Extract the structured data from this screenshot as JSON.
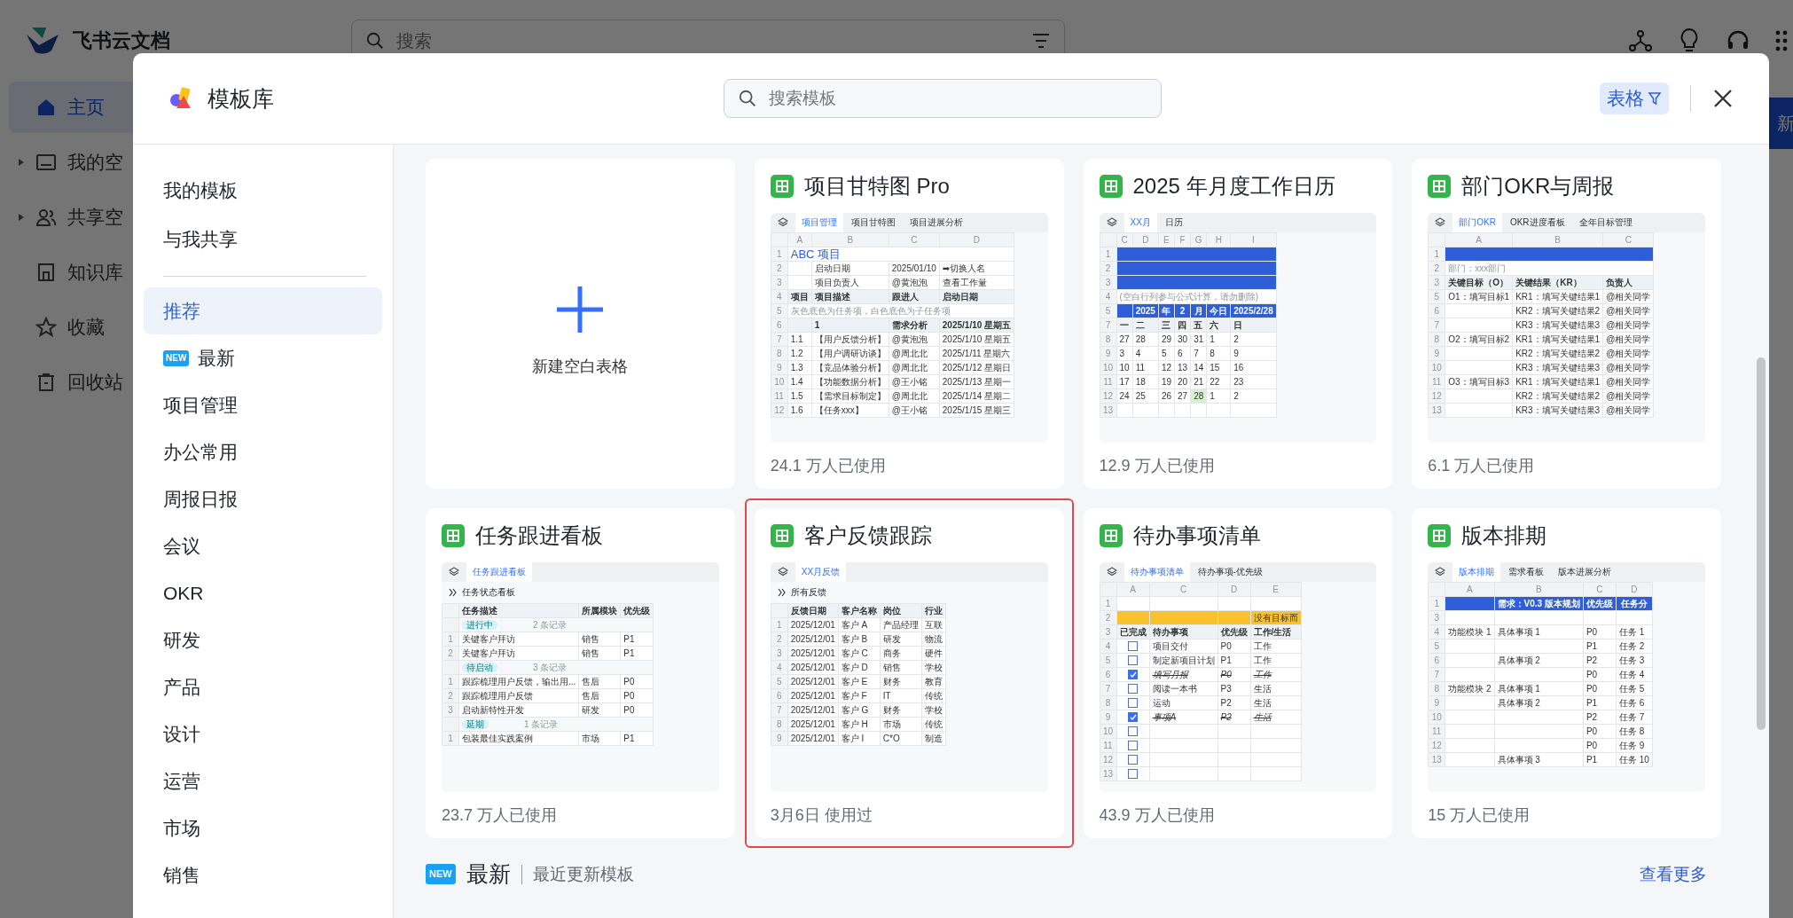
{
  "app": {
    "name": "飞书云文档",
    "search": {
      "placeholder": "搜索"
    },
    "new_button": "新",
    "nav": [
      {
        "label": "主页",
        "selected": true
      },
      {
        "label": "我的空",
        "selected": false,
        "expandable": true
      },
      {
        "label": "共享空",
        "selected": false,
        "expandable": true
      },
      {
        "label": "知识库",
        "selected": false
      },
      {
        "label": "收藏",
        "selected": false
      },
      {
        "label": "回收站",
        "selected": false
      }
    ]
  },
  "modal": {
    "title": "模板库",
    "search": {
      "placeholder": "搜索模板"
    },
    "filter": "表格",
    "my_links": [
      "我的模板",
      "与我共享"
    ],
    "categories": [
      {
        "label": "推荐",
        "selected": true
      },
      {
        "label": "最新",
        "selected": false,
        "badge": "NEW"
      },
      {
        "label": "项目管理",
        "selected": false
      },
      {
        "label": "办公常用",
        "selected": false
      },
      {
        "label": "周报日报",
        "selected": false
      },
      {
        "label": "会议",
        "selected": false
      },
      {
        "label": "OKR",
        "selected": false
      },
      {
        "label": "研发",
        "selected": false
      },
      {
        "label": "产品",
        "selected": false
      },
      {
        "label": "设计",
        "selected": false
      },
      {
        "label": "运营",
        "selected": false
      },
      {
        "label": "市场",
        "selected": false
      },
      {
        "label": "销售",
        "selected": false
      }
    ],
    "cards": [
      {
        "kind": "blank",
        "label": "新建空白表格"
      },
      {
        "kind": "template",
        "title": "项目甘特图 Pro",
        "usage": "24.1 万人已使用",
        "highlighted": false,
        "thumb": {
          "tabs": [
            {
              "label": "项目管理",
              "selected": true
            },
            {
              "label": "项目甘特图",
              "selected": false
            },
            {
              "label": "项目进展分析",
              "selected": false
            }
          ],
          "letters": [
            "A",
            "B",
            "C",
            "D"
          ],
          "rows": [
            {
              "n": "1",
              "kind": "title",
              "cells": [
                "ABC 项目"
              ]
            },
            {
              "n": "2",
              "kind": "row",
              "cells": [
                "启动日期",
                "2025/01/10",
                "➡切换人名"
              ]
            },
            {
              "n": "3",
              "kind": "row",
              "cells": [
                "项目负责人",
                "@黄泡泡",
                "查看工作量"
              ]
            },
            {
              "n": "4",
              "kind": "header",
              "cells": [
                "项目",
                "项目描述",
                "跟进人",
                "启动日期"
              ]
            },
            {
              "n": "5",
              "kind": "note",
              "cells": [
                "灰色底色为任务项，白色底色为子任务项"
              ]
            },
            {
              "n": "6",
              "kind": "header",
              "cells": [
                "1",
                "需求分析",
                "2025/1/10 星期五"
              ]
            },
            {
              "n": "7",
              "kind": "row",
              "cells": [
                "1.1",
                "【用户反馈分析】",
                "@黄泡泡",
                "2025/1/10 星期五"
              ]
            },
            {
              "n": "8",
              "kind": "row",
              "cells": [
                "1.2",
                "【用户调研访谈】",
                "@周北北",
                "2025/1/11 星期六"
              ]
            },
            {
              "n": "9",
              "kind": "row",
              "cells": [
                "1.3",
                "【竞品体验分析】",
                "@周北北",
                "2025/1/12 星期日"
              ]
            },
            {
              "n": "10",
              "kind": "row",
              "cells": [
                "1.4",
                "【功能数据分析】",
                "@王小铭",
                "2025/1/13 星期一"
              ]
            },
            {
              "n": "11",
              "kind": "row",
              "cells": [
                "1.5",
                "【需求目标制定】",
                "@周北北",
                "2025/1/14 星期二"
              ]
            },
            {
              "n": "12",
              "kind": "row",
              "cells": [
                "1.6",
                "【任务xxx】",
                "@王小铭",
                "2025/1/15 星期三"
              ]
            }
          ]
        }
      },
      {
        "kind": "template",
        "title": "2025 年月度工作日历",
        "usage": "12.9 万人已使用",
        "highlighted": false,
        "thumb": {
          "tabs": [
            {
              "label": "XX月",
              "selected": true
            },
            {
              "label": "日历",
              "selected": false
            }
          ],
          "letters": [
            "C",
            "D",
            "E",
            "F",
            "G",
            "H",
            "I"
          ],
          "rows": [
            {
              "n": "1",
              "kind": "band",
              "cells": []
            },
            {
              "n": "2",
              "kind": "band",
              "cells": []
            },
            {
              "n": "3",
              "kind": "band",
              "cells": []
            },
            {
              "n": "4",
              "kind": "note",
              "cells": [
                "(空白行列参与公式计算，请勿删除)"
              ]
            },
            {
              "n": "5",
              "kind": "band",
              "cells": [
                "",
                "2025",
                "年",
                "2",
                "月",
                "今日",
                "2025/2/28"
              ]
            },
            {
              "n": "7",
              "kind": "header",
              "cells": [
                "一",
                "二",
                "三",
                "四",
                "五",
                "六",
                "日"
              ]
            },
            {
              "n": "8",
              "kind": "row",
              "cells": [
                "27",
                "28",
                "29",
                "30",
                "31",
                "1",
                "2"
              ]
            },
            {
              "n": "9",
              "kind": "row",
              "cells": [
                "3",
                "4",
                "5",
                "6",
                "7",
                "8",
                "9"
              ]
            },
            {
              "n": "10",
              "kind": "row",
              "cells": [
                "10",
                "11",
                "12",
                "13",
                "14",
                "15",
                "16"
              ]
            },
            {
              "n": "11",
              "kind": "row",
              "cells": [
                "17",
                "18",
                "19",
                "20",
                "21",
                "22",
                "23"
              ]
            },
            {
              "n": "12",
              "kind": "row",
              "cells": [
                "24",
                "25",
                "26",
                "27",
                {
                  "text": "28",
                  "highlighted": true
                },
                "1",
                "2"
              ]
            },
            {
              "n": "13",
              "kind": "row",
              "cells": []
            }
          ]
        }
      },
      {
        "kind": "template",
        "title": "部门OKR与周报",
        "usage": "6.1 万人已使用",
        "highlighted": false,
        "thumb": {
          "tabs": [
            {
              "label": "部门OKR",
              "selected": true
            },
            {
              "label": "OKR进度看板",
              "selected": false
            },
            {
              "label": "全年目标管理",
              "selected": false
            }
          ],
          "letters": [
            "A",
            "B",
            "C"
          ],
          "rows": [
            {
              "n": "1",
              "kind": "band",
              "cells": []
            },
            {
              "n": "2",
              "kind": "note",
              "cells": [
                "部门：xxx部门"
              ]
            },
            {
              "n": "3",
              "kind": "header",
              "cells": [
                "关键目标（O）",
                "关键结果（KR）",
                "负责人"
              ]
            },
            {
              "n": "5",
              "kind": "row",
              "cells": [
                "O1：填写目标1",
                "KR1：填写关键结果1",
                "@相关同学"
              ]
            },
            {
              "n": "6",
              "kind": "row",
              "cells": [
                "KR2：填写关键结果2",
                "@相关同学"
              ]
            },
            {
              "n": "7",
              "kind": "row",
              "cells": [
                "KR3：填写关键结果3",
                "@相关同学"
              ]
            },
            {
              "n": "8",
              "kind": "row",
              "cells": [
                "O2：填写目标2",
                "KR1：填写关键结果1",
                "@相关同学"
              ]
            },
            {
              "n": "9",
              "kind": "row",
              "cells": [
                "KR2：填写关键结果2",
                "@相关同学"
              ]
            },
            {
              "n": "10",
              "kind": "row",
              "cells": [
                "KR3：填写关键结果3",
                "@相关同学"
              ]
            },
            {
              "n": "11",
              "kind": "row",
              "cells": [
                "O3：填写目标3",
                "KR1：填写关键结果1",
                "@相关同学"
              ]
            },
            {
              "n": "12",
              "kind": "row",
              "cells": [
                "KR2：填写关键结果2",
                "@相关同学"
              ]
            },
            {
              "n": "13",
              "kind": "row",
              "cells": [
                "KR3：填写关键结果3",
                "@相关同学"
              ]
            }
          ]
        }
      },
      {
        "kind": "template",
        "title": "任务跟进看板",
        "usage": "23.7 万人已使用",
        "highlighted": false,
        "thumb": {
          "tabs": [
            {
              "label": "任务跟进看板",
              "selected": true
            }
          ],
          "caption": "任务状态看板",
          "rows": [
            {
              "kind": "header",
              "cells": [
                "任务描述",
                "所属模块",
                "优先级"
              ]
            },
            {
              "kind": "group",
              "cells": [
                "进行中",
                "2 条记录"
              ]
            },
            {
              "n": "1",
              "kind": "row",
              "cells": [
                "关键客户拜访",
                "销售",
                "P1"
              ]
            },
            {
              "n": "2",
              "kind": "row",
              "cells": [
                "关键客户拜访",
                "销售",
                "P1"
              ]
            },
            {
              "kind": "group",
              "cells": [
                "待启动",
                "3 条记录"
              ]
            },
            {
              "n": "1",
              "kind": "row",
              "cells": [
                "跟踪梳理用户反馈，输出用...",
                "售后",
                "P0"
              ]
            },
            {
              "n": "2",
              "kind": "row",
              "cells": [
                "跟踪梳理用户反馈",
                "售后",
                "P0"
              ]
            },
            {
              "n": "3",
              "kind": "row",
              "cells": [
                "启动新特性开发",
                "研发",
                "P0"
              ]
            },
            {
              "kind": "group",
              "cells": [
                "延期",
                "1 条记录"
              ]
            },
            {
              "n": "1",
              "kind": "row",
              "cells": [
                "包装最佳实践案例",
                "市场",
                "P1"
              ]
            }
          ]
        }
      },
      {
        "kind": "template",
        "title": "客户反馈跟踪",
        "usage": "3月6日 使用过",
        "highlighted": true,
        "thumb": {
          "tabs": [
            {
              "label": "XX月反馈",
              "selected": true
            }
          ],
          "caption": "所有反馈",
          "rows": [
            {
              "kind": "header",
              "cells": [
                "反馈日期",
                "客户名称",
                "岗位",
                "行业"
              ]
            },
            {
              "n": "1",
              "kind": "row",
              "cells": [
                "2025/12/01",
                "客户 A",
                "产品经理",
                "互联"
              ]
            },
            {
              "n": "2",
              "kind": "row",
              "cells": [
                "2025/12/01",
                "客户 B",
                "研发",
                "物流"
              ]
            },
            {
              "n": "3",
              "kind": "row",
              "cells": [
                "2025/12/01",
                "客户 C",
                "商务",
                "硬件"
              ]
            },
            {
              "n": "4",
              "kind": "row",
              "cells": [
                "2025/12/01",
                "客户 D",
                "销售",
                "学校"
              ]
            },
            {
              "n": "5",
              "kind": "row",
              "cells": [
                "2025/12/01",
                "客户 E",
                "财务",
                "教育"
              ]
            },
            {
              "n": "6",
              "kind": "row",
              "cells": [
                "2025/12/01",
                "客户 F",
                "IT",
                "传统"
              ]
            },
            {
              "n": "7",
              "kind": "row",
              "cells": [
                "2025/12/01",
                "客户 G",
                "财务",
                "学校"
              ]
            },
            {
              "n": "8",
              "kind": "row",
              "cells": [
                "2025/12/01",
                "客户 H",
                "市场",
                "传统"
              ]
            },
            {
              "n": "9",
              "kind": "row",
              "cells": [
                "2025/12/01",
                "客户 I",
                "C*O",
                "制造"
              ]
            }
          ]
        }
      },
      {
        "kind": "template",
        "title": "待办事项清单",
        "usage": "43.9 万人已使用",
        "highlighted": false,
        "thumb": {
          "tabs": [
            {
              "label": "待办事项清单",
              "selected": true
            },
            {
              "label": "待办事项-优先级",
              "selected": false
            }
          ],
          "letters": [
            "A",
            "C",
            "D",
            "E"
          ],
          "rows": [
            {
              "n": "1",
              "kind": "row",
              "cells": []
            },
            {
              "n": "2",
              "kind": "banner",
              "cells": [
                "",
                "",
                "",
                "没有目标而"
              ]
            },
            {
              "n": "3",
              "kind": "header",
              "cells": [
                "已完成",
                "待办事项",
                "优先级",
                "工作/生活"
              ]
            },
            {
              "n": "4",
              "kind": "row",
              "check": false,
              "cells": [
                "",
                "项目交付",
                "P0",
                "工作"
              ]
            },
            {
              "n": "5",
              "kind": "row",
              "check": false,
              "cells": [
                "",
                "制定新项目计划",
                "P1",
                "工作"
              ]
            },
            {
              "n": "6",
              "kind": "row",
              "check": true,
              "cells": [
                "",
                "填写月报",
                "P0",
                "工作"
              ]
            },
            {
              "n": "7",
              "kind": "row",
              "check": false,
              "cells": [
                "",
                "阅读一本书",
                "P3",
                "生活"
              ]
            },
            {
              "n": "8",
              "kind": "row",
              "check": false,
              "cells": [
                "",
                "运动",
                "P2",
                "生活"
              ]
            },
            {
              "n": "9",
              "kind": "row",
              "check": true,
              "cells": [
                "",
                "事项A",
                "P2",
                "生活"
              ]
            },
            {
              "n": "10",
              "kind": "row",
              "check": false,
              "cells": [
                "",
                "",
                "",
                ""
              ]
            },
            {
              "n": "11",
              "kind": "row",
              "check": false,
              "cells": [
                "",
                "",
                "",
                ""
              ]
            },
            {
              "n": "12",
              "kind": "row",
              "check": false,
              "cells": [
                "",
                "",
                "",
                ""
              ]
            },
            {
              "n": "13",
              "kind": "row",
              "check": false,
              "cells": [
                "",
                "",
                "",
                ""
              ]
            }
          ]
        }
      },
      {
        "kind": "template",
        "title": "版本排期",
        "usage": "15 万人已使用",
        "highlighted": false,
        "thumb": {
          "tabs": [
            {
              "label": "版本排期",
              "selected": true
            },
            {
              "label": "需求看板",
              "selected": false
            },
            {
              "label": "版本进展分析",
              "selected": false
            }
          ],
          "letters": [
            "A",
            "B",
            "C",
            "D"
          ],
          "rows": [
            {
              "n": "1",
              "kind": "band",
              "cells": [
                "需求：V0.3 版本规划",
                "优先级",
                "任务分"
              ]
            },
            {
              "n": "3",
              "kind": "row",
              "cells": []
            },
            {
              "n": "4",
              "kind": "row",
              "cells": [
                "功能模块 1",
                "具体事项 1",
                "P0",
                "任务 1"
              ]
            },
            {
              "n": "5",
              "kind": "row",
              "cells": [
                "P1",
                "任务 2"
              ]
            },
            {
              "n": "6",
              "kind": "row",
              "cells": [
                "具体事项 2",
                "P2",
                "任务 3"
              ]
            },
            {
              "n": "7",
              "kind": "row",
              "cells": [
                "P0",
                "任务 4"
              ]
            },
            {
              "n": "8",
              "kind": "row",
              "cells": [
                "功能模块 2",
                "具体事项 1",
                "P0",
                "任务 5"
              ]
            },
            {
              "n": "9",
              "kind": "row",
              "cells": [
                "具体事项 2",
                "P1",
                "任务 6"
              ]
            },
            {
              "n": "10",
              "kind": "row",
              "cells": [
                "P2",
                "任务 7"
              ]
            },
            {
              "n": "11",
              "kind": "row",
              "cells": [
                "P0",
                "任务 8"
              ]
            },
            {
              "n": "12",
              "kind": "row",
              "cells": [
                "P0",
                "任务 9"
              ]
            },
            {
              "n": "13",
              "kind": "row",
              "cells": [
                "具体事项 3",
                "P1",
                "任务 10"
              ]
            }
          ]
        }
      }
    ],
    "latest": {
      "badge": "NEW",
      "title": "最新",
      "subtitle": "最近更新模板",
      "more": "查看更多"
    }
  }
}
